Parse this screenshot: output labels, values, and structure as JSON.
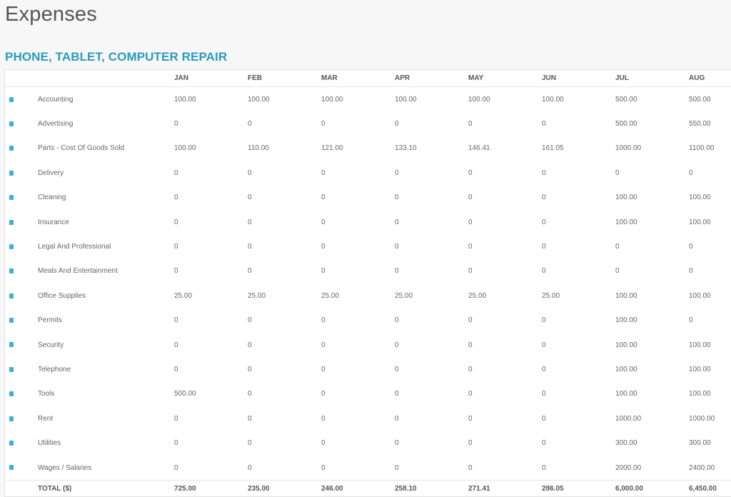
{
  "page": {
    "title": "Expenses",
    "section_title": "PHONE, TABLET, COMPUTER REPAIR"
  },
  "table": {
    "months": [
      "JAN",
      "FEB",
      "MAR",
      "APR",
      "MAY",
      "JUN",
      "JUL",
      "AUG"
    ],
    "rows": [
      {
        "name": "Accounting",
        "values": [
          "100.00",
          "100.00",
          "100.00",
          "100.00",
          "100.00",
          "100.00",
          "500.00",
          "500.00"
        ]
      },
      {
        "name": "Advertising",
        "values": [
          "0",
          "0",
          "0",
          "0",
          "0",
          "0",
          "500.00",
          "550.00"
        ]
      },
      {
        "name": "Parts - Cost Of Goods Sold",
        "values": [
          "100.00",
          "110.00",
          "121.00",
          "133.10",
          "146.41",
          "161.05",
          "1000.00",
          "1100.00"
        ]
      },
      {
        "name": "Delivery",
        "values": [
          "0",
          "0",
          "0",
          "0",
          "0",
          "0",
          "0",
          "0"
        ]
      },
      {
        "name": "Cleaning",
        "values": [
          "0",
          "0",
          "0",
          "0",
          "0",
          "0",
          "100.00",
          "100.00"
        ]
      },
      {
        "name": "Insurance",
        "values": [
          "0",
          "0",
          "0",
          "0",
          "0",
          "0",
          "100.00",
          "100.00"
        ]
      },
      {
        "name": "Legal And Professional",
        "values": [
          "0",
          "0",
          "0",
          "0",
          "0",
          "0",
          "0",
          "0"
        ]
      },
      {
        "name": "Meals And Entertainment",
        "values": [
          "0",
          "0",
          "0",
          "0",
          "0",
          "0",
          "0",
          "0"
        ]
      },
      {
        "name": "Office Supplies",
        "values": [
          "25.00",
          "25.00",
          "25.00",
          "25.00",
          "25.00",
          "25.00",
          "100.00",
          "100.00"
        ]
      },
      {
        "name": "Permits",
        "values": [
          "0",
          "0",
          "0",
          "0",
          "0",
          "0",
          "100.00",
          "0"
        ]
      },
      {
        "name": "Security",
        "values": [
          "0",
          "0",
          "0",
          "0",
          "0",
          "0",
          "100.00",
          "100.00"
        ]
      },
      {
        "name": "Telephone",
        "values": [
          "0",
          "0",
          "0",
          "0",
          "0",
          "0",
          "100.00",
          "100.00"
        ]
      },
      {
        "name": "Tools",
        "values": [
          "500.00",
          "0",
          "0",
          "0",
          "0",
          "0",
          "100.00",
          "100.00"
        ]
      },
      {
        "name": "Rent",
        "values": [
          "0",
          "0",
          "0",
          "0",
          "0",
          "0",
          "1000.00",
          "1000.00"
        ]
      },
      {
        "name": "Utilities",
        "values": [
          "0",
          "0",
          "0",
          "0",
          "0",
          "0",
          "300.00",
          "300.00"
        ]
      },
      {
        "name": "Wages / Salaries",
        "values": [
          "0",
          "0",
          "0",
          "0",
          "0",
          "0",
          "2000.00",
          "2400.00"
        ]
      }
    ],
    "total_label": "TOTAL ($)",
    "totals": [
      "725.00",
      "235.00",
      "246.00",
      "258.10",
      "271.41",
      "286.05",
      "6,000.00",
      "6,450.00"
    ]
  },
  "icons": {
    "row_icon": "expense-category-icon",
    "accent_color": "#3bb0d8",
    "section_color": "#2a9bbf"
  }
}
